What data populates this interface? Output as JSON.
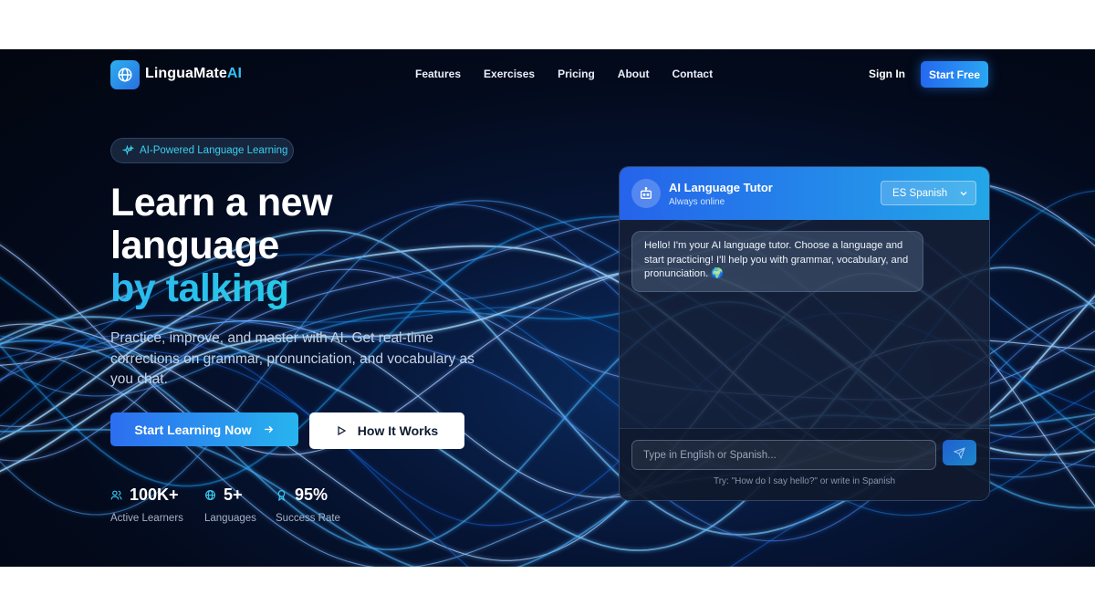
{
  "brand": {
    "name_main": "LinguaMate",
    "name_accent": "AI",
    "icon": "globe-icon"
  },
  "nav": {
    "links": [
      "Features",
      "Exercises",
      "Pricing",
      "About",
      "Contact"
    ],
    "sign_in": "Sign In",
    "start_free": "Start Free"
  },
  "hero": {
    "badge": "AI-Powered Language Learning",
    "title_line1": "Learn a new",
    "title_line2": "language",
    "title_line3": "by talking",
    "subtitle": "Practice, improve, and master with AI. Get real-time corrections on grammar, pronunciation, and vocabulary as you chat.",
    "primary_button": "Start Learning Now",
    "secondary_button": "How It Works"
  },
  "stats": [
    {
      "value": "100K+",
      "label": "Active Learners",
      "icon": "users-icon"
    },
    {
      "value": "5+",
      "label": "Languages",
      "icon": "globe-icon"
    },
    {
      "value": "95%",
      "label": "Success Rate",
      "icon": "award-icon"
    }
  ],
  "chat": {
    "title": "AI Language Tutor",
    "status": "Always online",
    "selected_language": "ES Spanish",
    "message": "Hello! I'm your AI language tutor. Choose a language and start practicing! I'll help you with grammar, vocabulary, and pronunciation. 🌍",
    "input_placeholder": "Type in English or Spanish...",
    "hint": "Try: \"How do I say hello?\" or write in Spanish"
  },
  "colors": {
    "accent_blue": "#2563eb",
    "accent_cyan": "#27b4ee",
    "background_dark": "#030a1c"
  }
}
